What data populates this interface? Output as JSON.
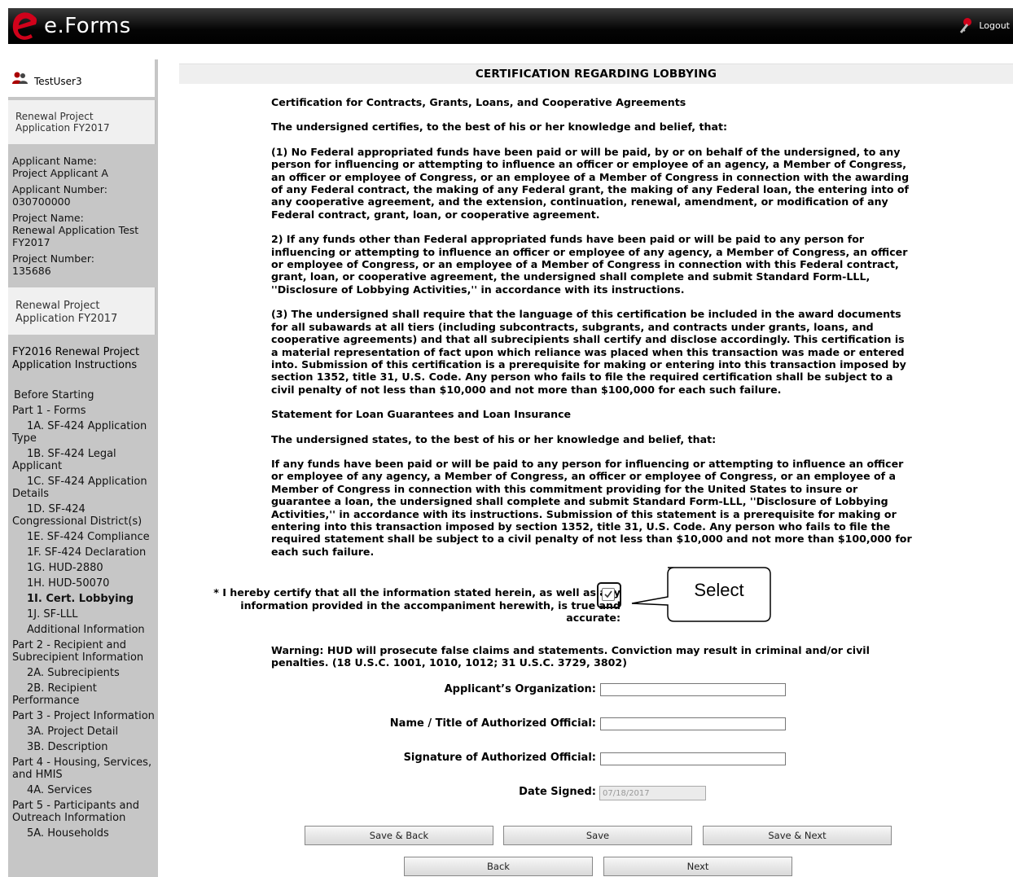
{
  "header": {
    "logo_text": "e.Forms",
    "logout_label": "Logout"
  },
  "sidebar": {
    "user": "TestUser3",
    "box1": "Renewal Project Application FY2017",
    "info": [
      {
        "label": "Applicant Name:",
        "value": "Project Applicant A"
      },
      {
        "label": "Applicant Number:",
        "value": "030700000"
      },
      {
        "label": "Project Name:",
        "value": "Renewal Application Test FY2017"
      },
      {
        "label": "Project Number:",
        "value": "135686"
      }
    ],
    "box2": "Renewal Project Application FY2017",
    "box3": "FY2016 Renewal Project Application Instructions",
    "nav": [
      "Before Starting",
      "Part 1 - Forms",
      "1A. SF-424 Application Type",
      "1B. SF-424 Legal Applicant",
      "1C. SF-424 Application Details",
      "1D. SF-424 Congressional District(s)",
      "1E. SF-424 Compliance",
      "1F. SF-424 Declaration",
      "1G. HUD-2880",
      "1H. HUD-50070",
      "1I. Cert. Lobbying",
      "1J. SF-LLL",
      "Additional Information",
      "Part 2 - Recipient and Subrecipient Information",
      "2A. Subrecipients",
      "2B. Recipient Performance",
      "Part 3 - Project Information",
      "3A. Project Detail",
      "3B. Description",
      "Part 4 - Housing, Services, and HMIS",
      "4A. Services",
      "Part 5 - Participants and Outreach Information",
      "5A. Households"
    ]
  },
  "main": {
    "title": "CERTIFICATION REGARDING LOBBYING",
    "paragraphs": [
      "Certification for Contracts, Grants, Loans, and Cooperative Agreements",
      "The undersigned certifies, to the best of his or her knowledge and belief, that:",
      "(1) No Federal appropriated funds have been paid or will be paid, by or on behalf of the undersigned, to any person for influencing or attempting to influence an officer or employee of an agency, a Member of Congress, an officer or employee of Congress, or an employee of a Member of Congress in connection with the awarding of any Federal contract, the making of any Federal grant, the making of any Federal loan, the entering into of any cooperative agreement, and the extension, continuation, renewal, amendment, or modification of any Federal contract, grant, loan, or cooperative agreement.",
      "2) If any funds other than Federal appropriated funds have been paid or will be paid to any person for influencing or attempting to influence an officer or employee of any agency, a Member of Congress, an officer or employee of Congress, or an employee of a Member of Congress in connection with this Federal contract, grant, loan, or cooperative agreement, the undersigned shall complete and submit Standard Form-LLL, ''Disclosure of Lobbying Activities,'' in accordance with its instructions.",
      "(3) The undersigned shall require that the language of this certification be included in the award documents for all subawards at all tiers (including subcontracts, subgrants, and contracts under grants, loans, and cooperative agreements) and that all subrecipients shall certify and disclose accordingly. This certification is a material representation of fact upon which reliance was placed when this transaction was made or entered into. Submission of this certification is a prerequisite for making or entering into this transaction imposed by section 1352, title 31, U.S. Code. Any person who fails to file the required certification shall be subject to a civil penalty of not less than $10,000 and not more than $100,000 for each such failure.",
      "Statement for Loan Guarantees and Loan Insurance",
      "The undersigned states, to the best of his or her knowledge and belief, that:",
      "If any funds have been paid or will be paid to any person for influencing or attempting to influence an officer or employee of any agency, a Member of Congress, an officer or employee of Congress, or an employee of a Member of Congress in connection with this commitment providing for the United States to insure or guarantee a loan, the undersigned shall complete and submit Standard Form-LLL, ''Disclosure of Lobbying Activities,'' in accordance with its instructions. Submission of this statement is a prerequisite for making or entering into this transaction imposed by section 1352, title 31, U.S. Code. Any person who fails to file the required statement shall be subject to a civil penalty of not less than $10,000 and not more than $100,000 for each such failure."
    ],
    "certify_text": "* I hereby certify that all the information stated herein, as well as any information provided in the accompaniment herewith, is true and accurate:",
    "certify_checked": true,
    "callout_text": "Select",
    "warning": "Warning: HUD will prosecute false claims and statements. Conviction may result in criminal and/or civil penalties. (18 U.S.C. 1001, 1010, 1012; 31 U.S.C. 3729, 3802)",
    "fields": {
      "org_label": "Applicant’s Organization:",
      "org_value": "",
      "name_label": "Name / Title of Authorized Official:",
      "name_value": "",
      "sig_label": "Signature of Authorized Official:",
      "sig_value": "",
      "date_label": "Date Signed:",
      "date_value": "07/18/2017"
    },
    "buttons": {
      "save_back": "Save & Back",
      "save": "Save",
      "save_next": "Save & Next",
      "back": "Back",
      "next": "Next"
    }
  },
  "colors": {
    "accent_red": "#d0021b",
    "header_bg": "#000000",
    "sidebar_bg": "#c6c6c6"
  }
}
